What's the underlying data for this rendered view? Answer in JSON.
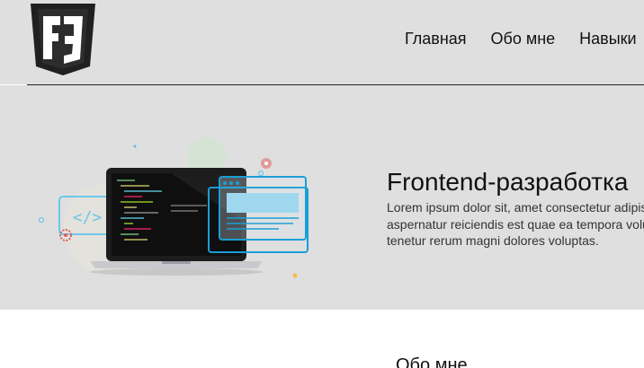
{
  "header": {
    "logo_icon": "f3-shield-logo-icon",
    "nav": [
      "Главная",
      "Обо мне",
      "Навыки"
    ]
  },
  "hero": {
    "title": "Frontend-разработка",
    "text": "Lorem ipsum dolor sit, amet consectetur adipisicing elit. Natus aspernatur reiciendis est quae ea tempora voluptates, commodi qui tenetur rerum magni dolores voluptas.",
    "illustration_icon": "laptop-code-illustration",
    "code_icon": "code-tag-icon",
    "gear_icon": "gear-icon"
  },
  "about": {
    "title": "Обо мне"
  },
  "colors": {
    "background": "#dfdfdf",
    "accent": "#1a9fd6",
    "text": "#111111"
  }
}
